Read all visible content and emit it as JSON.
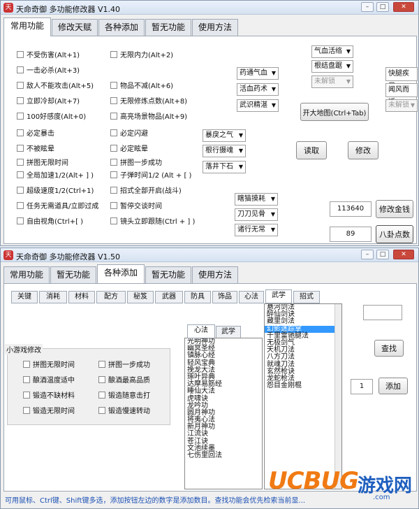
{
  "window1": {
    "title": "天命奇御 多功能修改器  V1.40",
    "tabs": [
      "常用功能",
      "修改天赋",
      "各种添加",
      "暂无功能",
      "使用方法"
    ],
    "active_tab": 0,
    "left_checks": [
      "不受伤害(Alt+1)",
      "一击必杀(Alt+3)",
      "敌人不能攻击(Alt+5)",
      "立即冷却(Alt+7)",
      "100好感度(Alt+0)",
      "必定暴击",
      "不被眩晕",
      "拼图无限时间",
      "全局加速1/2(Alt+ ] )",
      "超级速度1/2(Ctrl+1)",
      "任务无需道具/立即过成",
      "自由视角(Ctrl+[ )"
    ],
    "mid_checks": [
      "无限内力(Alt+2)",
      "物品不减(Alt+6)",
      "无限修炼点数(Alt+8)",
      "高亮场景物品(Alt+9)",
      "必定闪避",
      "必定眩晕",
      "拼图一步成功",
      "子弹时间1/2 (Alt + [ )",
      "招式全部开启(战斗)",
      "暂停交谈时间",
      "镜头立即跟随(Ctrl + ] )"
    ],
    "selects_a": [
      "药通气血",
      "活血药术",
      "武识精湛"
    ],
    "selects_b": [
      "暴戾之气",
      "根行摄魂",
      "落井下石"
    ],
    "selects_c": [
      "瞎猫摸耗",
      "刀刀见骨",
      "诸行无常"
    ],
    "selects_top": [
      "气血活络",
      "根结盘踞"
    ],
    "select_locked": "未解锁",
    "right_labels": [
      "快腿疾足",
      "闻风而遁"
    ],
    "right_locked": "未解锁",
    "map_button": "开大地图(Ctrl+Tab)",
    "read_button": "读取",
    "modify_button": "修改",
    "money_value": "113640",
    "money_button": "修改金钱",
    "bagua_value": "89",
    "bagua_button": "八卦点数"
  },
  "window2": {
    "title": "天命奇御 多功能修改器  V1.50",
    "tabs": [
      "常用功能",
      "暂无功能",
      "各种添加",
      "暂无功能",
      "使用方法"
    ],
    "active_tab": 2,
    "subtabs": [
      "关键",
      "消耗",
      "材料",
      "配方",
      "秘笈",
      "武器",
      "防具",
      "饰品",
      "心法",
      "武学",
      "招式"
    ],
    "active_subtab": 9,
    "mini_group_title": "小游戏修改",
    "mini_checks": [
      "拼图无限时间",
      "拼图一步成功",
      "酿酒温度适中",
      "酿酒最高品质",
      "锻造不缺材料",
      "锻造随意击打",
      "锻造无限时间",
      "锻造慢速转动"
    ],
    "inner_tabs": [
      "心法",
      "武学"
    ],
    "xinfa_list": [
      "光明神功",
      "幽冥圣经",
      "镇脉心经",
      "轻风宝典",
      "挽龙大法",
      "琢叶异典",
      "达摩易筋经",
      "睡仙大法",
      "虎啸诀",
      "龙吟功",
      "圆月神功",
      "将夷心法",
      "新月神功",
      "江流诀",
      "苍江诀",
      "文池续墨",
      "七伤里回法"
    ],
    "wuxue_list": [
      "悬河剑法",
      "醉仙剑诀",
      "藏里剑法",
      "幻影迷踪掌",
      "千里雷驰腿法",
      "无极剑气",
      "天机刀法",
      "八方刀法",
      "就魂刀法",
      "玄然枪诀",
      "龙蛇枪法",
      "怨目金刚棍"
    ],
    "wuxue_selected": 3,
    "search_value": "",
    "search_button": "查找",
    "qty_value": "1",
    "add_button": "添加",
    "status_text": "可用鼠标、Ctrl键、Shift键多选，添加按钮左边的数字是添加数目。查找功能会优先检索当前显...",
    "logo_ucbug": "UCBUG",
    "logo_cn": "游戏网",
    "logo_url": ".com"
  },
  "colors": {
    "selection": "#3399ff",
    "logo_orange": "#f07a13",
    "logo_blue": "#1f5fbf"
  }
}
